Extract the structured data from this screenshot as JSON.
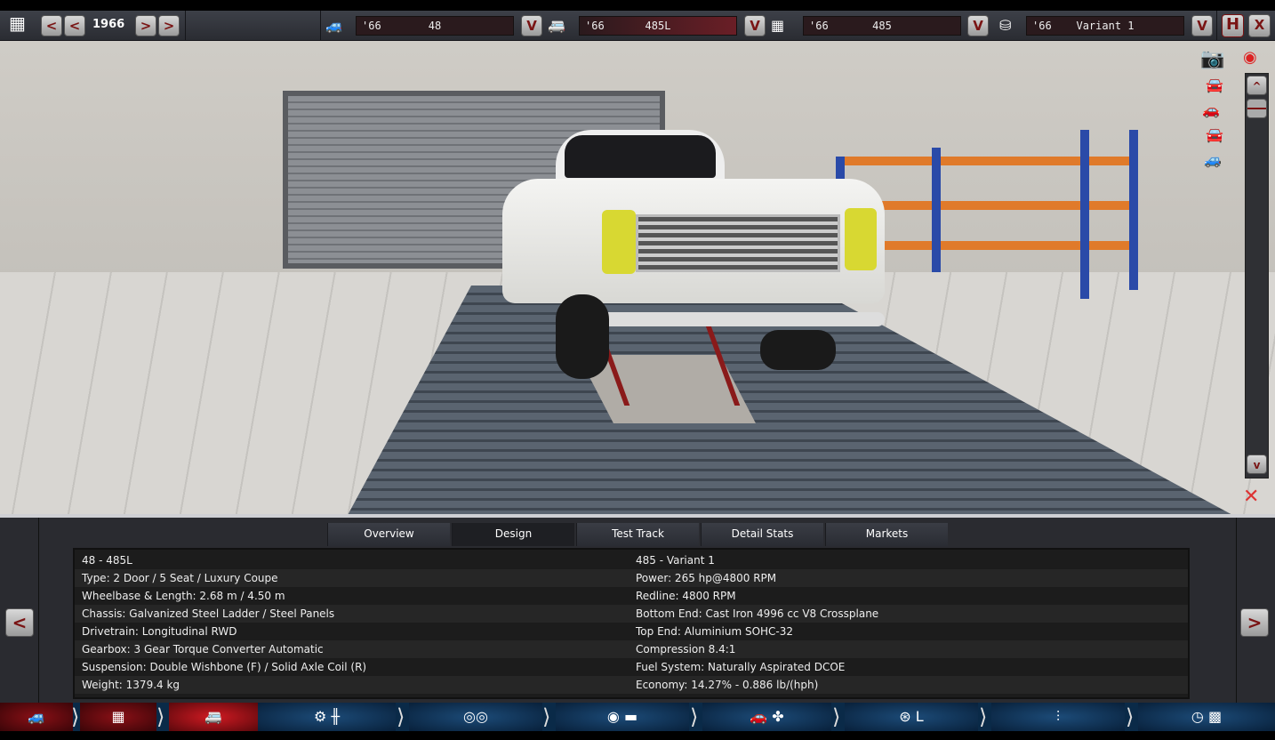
{
  "top_bar": {
    "year": "1966",
    "selectors": [
      {
        "icon": "car-model-icon",
        "year": "'66",
        "value": "48"
      },
      {
        "icon": "car-trim-icon",
        "year": "'66",
        "value": "485L"
      },
      {
        "icon": "engine-family-icon",
        "year": "'66",
        "value": "485"
      },
      {
        "icon": "engine-variant-icon",
        "year": "'66",
        "value": "Variant 1"
      }
    ],
    "dropdown_label": "V",
    "prev_label": "<",
    "next_label": ">",
    "save_label": "H",
    "close_label": "X"
  },
  "scroll": {
    "up": "^",
    "down": "v"
  },
  "tabs": [
    {
      "label": "Overview",
      "active": false
    },
    {
      "label": "Design",
      "active": true
    },
    {
      "label": "Test Track",
      "active": false
    },
    {
      "label": "Detail Stats",
      "active": false
    },
    {
      "label": "Markets",
      "active": false
    }
  ],
  "stats": {
    "left": [
      "48 - 485L",
      "Type: 2 Door / 5 Seat / Luxury Coupe",
      "Wheelbase & Length: 2.68 m / 4.50 m",
      "Chassis: Galvanized Steel Ladder / Steel Panels",
      "Drivetrain: Longitudinal RWD",
      "Gearbox: 3 Gear Torque Converter Automatic",
      "Suspension: Double Wishbone (F) / Solid Axle Coil (R)",
      "Weight: 1379.4 kg"
    ],
    "right": [
      "485 - Variant 1",
      "Power: 265 hp@4800 RPM",
      "Redline: 4800 RPM",
      "Bottom End: Cast Iron 4996 cc V8 Crossplane",
      "Top End: Aluminium SOHC-32",
      "Compression 8.4:1",
      "Fuel System: Naturally Aspirated DCOE",
      "Economy: 14.27% - 0.886 lb/(hph)"
    ]
  },
  "panel_nav": {
    "prev": "<",
    "next": ">"
  },
  "bottom_nav": [
    {
      "name": "car-model",
      "glyph": "🚙"
    },
    {
      "name": "engine",
      "glyph": "▦"
    },
    {
      "name": "body-trim",
      "glyph": "🚐"
    },
    {
      "name": "drivetrain",
      "glyph": "⚙ ╫"
    },
    {
      "name": "wheels",
      "glyph": "◎◎"
    },
    {
      "name": "brakes",
      "glyph": "◉ ▬"
    },
    {
      "name": "aero",
      "glyph": "🚗 ✤"
    },
    {
      "name": "interior",
      "glyph": "⊛ L"
    },
    {
      "name": "suspension",
      "glyph": "⫶"
    },
    {
      "name": "test-drive",
      "glyph": "◷ ▩"
    }
  ],
  "colors": {
    "accent_red": "#7a1414",
    "active_red": "#d01a22",
    "nav_blue": "#1c4b78"
  }
}
